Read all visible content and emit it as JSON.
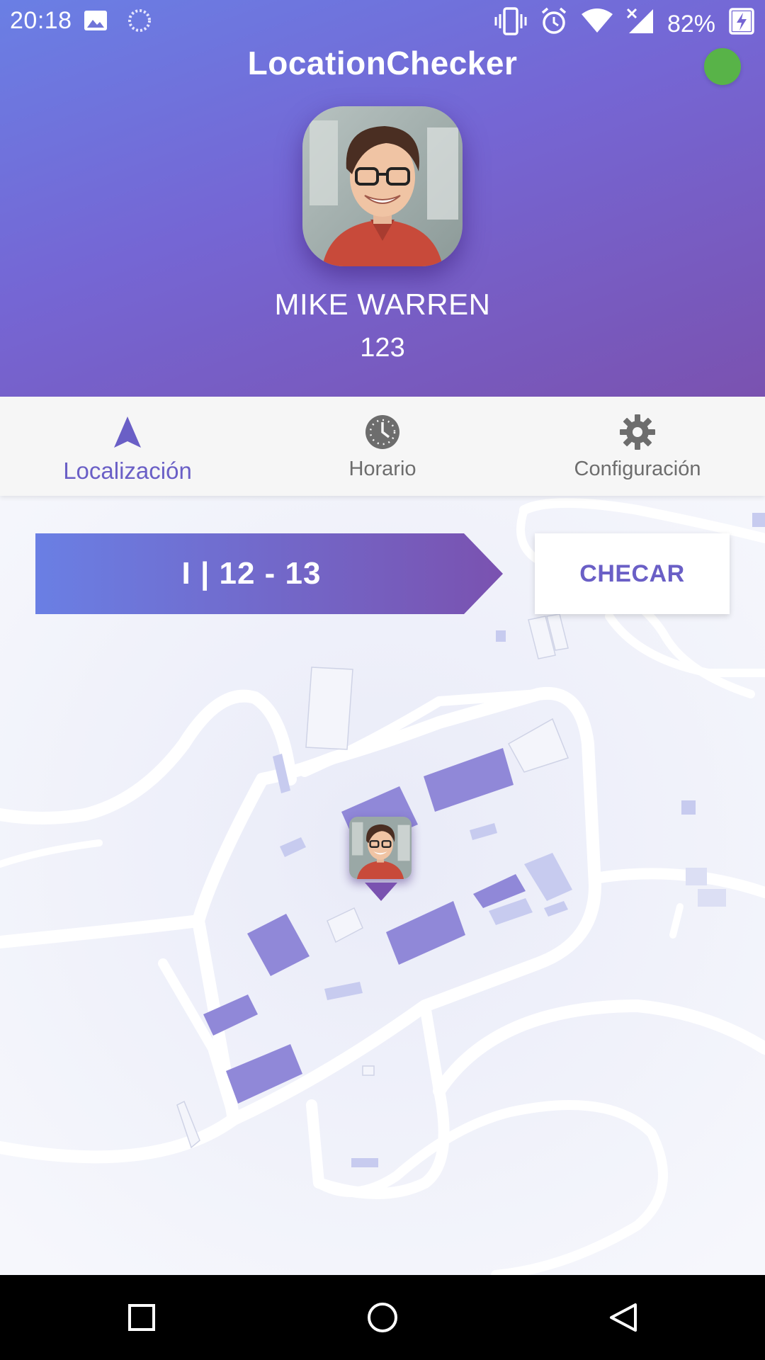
{
  "status_bar": {
    "time": "20:18",
    "battery_percent": "82%",
    "icons": [
      "image-icon",
      "sync-icon",
      "vibrate-icon",
      "alarm-icon",
      "wifi-icon",
      "no-signal-icon",
      "battery-charging-icon"
    ]
  },
  "header": {
    "app_title": "LocationChecker",
    "status_color": "#58b348",
    "user_name": "MIKE WARREN",
    "user_id": "123"
  },
  "tabs": [
    {
      "label": "Localización",
      "icon": "navigation-arrow-icon",
      "active": true
    },
    {
      "label": "Horario",
      "icon": "clock-icon",
      "active": false
    },
    {
      "label": "Configuración",
      "icon": "gear-icon",
      "active": false
    }
  ],
  "map": {
    "period_label": "I | 12 - 13",
    "check_button_label": "CHECAR"
  },
  "colors": {
    "accent": "#6a5fc6",
    "gradient_start": "#6a7fe4",
    "gradient_end": "#7a52b0",
    "building": "#9088d8"
  },
  "nav_bar": {
    "buttons": [
      "recent-apps-icon",
      "home-icon",
      "back-icon"
    ]
  }
}
